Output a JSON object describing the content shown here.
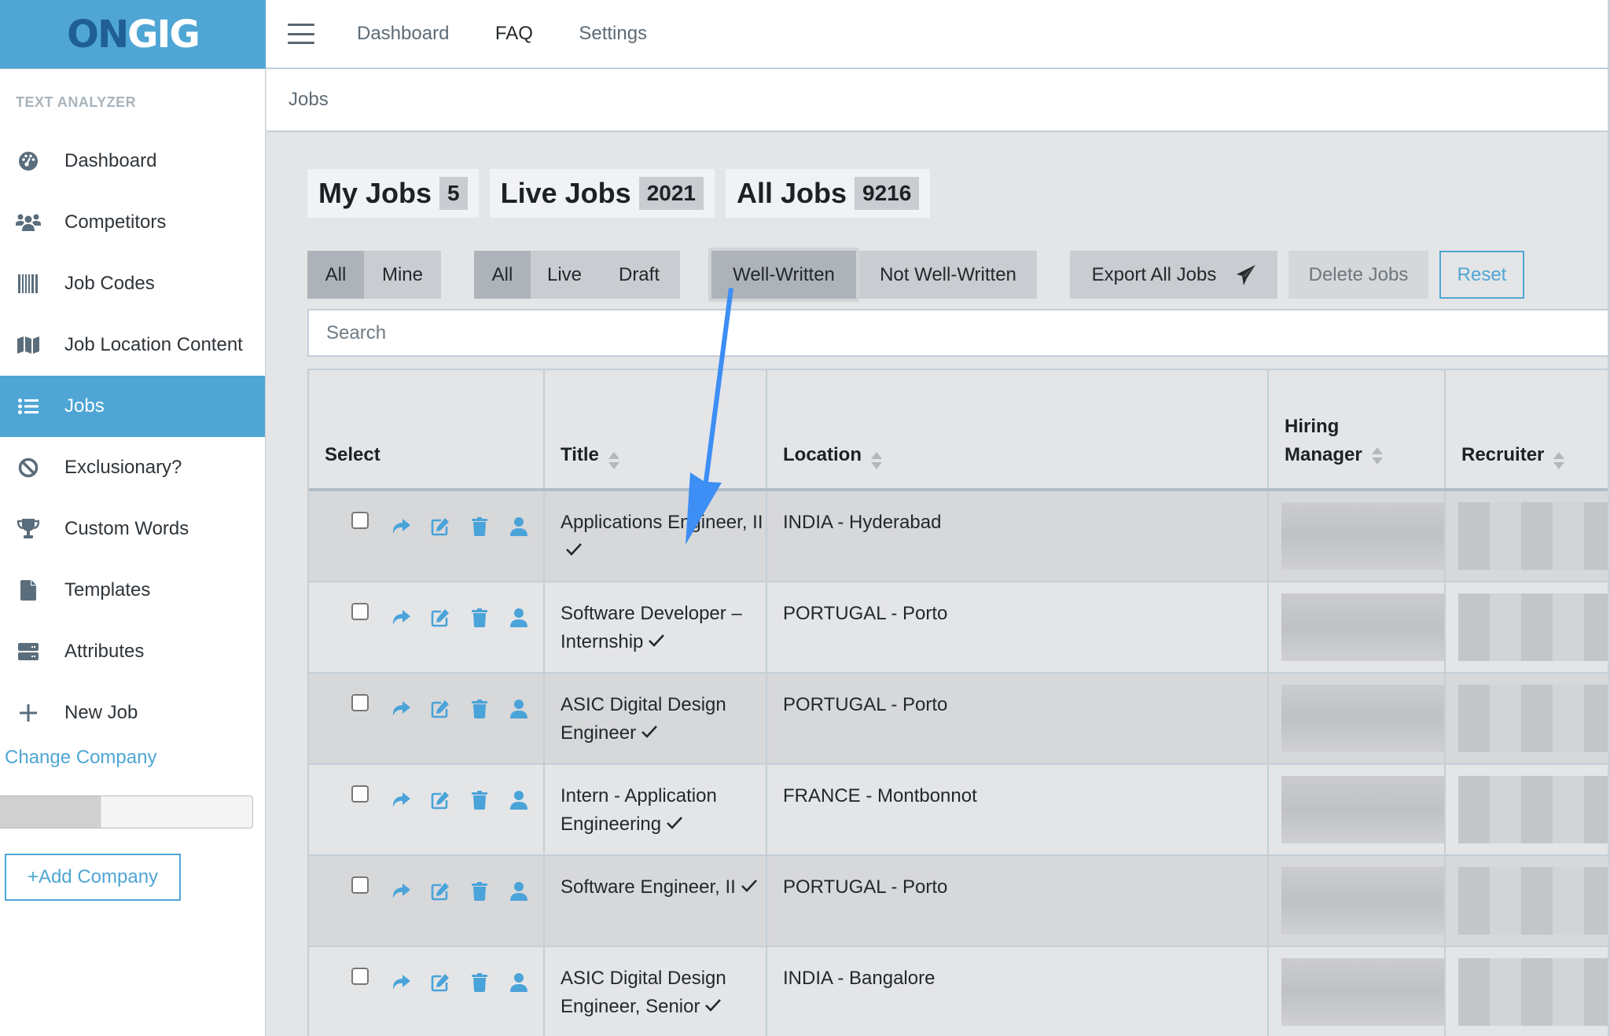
{
  "brand": {
    "logo_part1": "ON",
    "logo_part2": "GIG"
  },
  "topnav": {
    "items": [
      "Dashboard",
      "FAQ",
      "Settings"
    ]
  },
  "sidebar": {
    "section_title": "TEXT ANALYZER",
    "items": [
      {
        "label": "Dashboard",
        "icon": "tachometer-icon"
      },
      {
        "label": "Competitors",
        "icon": "users-icon"
      },
      {
        "label": "Job Codes",
        "icon": "barcode-icon"
      },
      {
        "label": "Job Location Content",
        "icon": "map-icon"
      },
      {
        "label": "Jobs",
        "icon": "list-icon",
        "active": true
      },
      {
        "label": "Exclusionary?",
        "icon": "ban-icon"
      },
      {
        "label": "Custom Words",
        "icon": "trophy-icon"
      },
      {
        "label": "Templates",
        "icon": "file-icon"
      },
      {
        "label": "Attributes",
        "icon": "server-icon"
      },
      {
        "label": "New Job",
        "icon": "plus-icon"
      }
    ],
    "change_company": "Change Company",
    "add_company": "+Add Company"
  },
  "breadcrumb": "Jobs",
  "job_tabs": [
    {
      "label": "My Jobs",
      "count": "5"
    },
    {
      "label": "Live Jobs",
      "count": "2021"
    },
    {
      "label": "All Jobs",
      "count": "9216"
    }
  ],
  "filters": {
    "owner": {
      "options": [
        "All",
        "Mine"
      ],
      "active": "All"
    },
    "status": {
      "options": [
        "All",
        "Live",
        "Draft"
      ],
      "active": "All"
    },
    "quality": {
      "options": [
        "Well-Written",
        "Not Well-Written"
      ],
      "active": "Well-Written"
    },
    "export_label": "Export All Jobs",
    "delete_label": "Delete Jobs",
    "reset_label": "Reset"
  },
  "search": {
    "placeholder": "Search",
    "value": ""
  },
  "table": {
    "columns": [
      "Select",
      "Title",
      "Location",
      "Hiring Manager",
      "Recruiter"
    ],
    "rows": [
      {
        "title": "Applications Engineer, II",
        "location": "INDIA - Hyderabad",
        "well_written": true
      },
      {
        "title": "Software Developer – Internship",
        "location": "PORTUGAL - Porto",
        "well_written": true
      },
      {
        "title": "ASIC Digital Design Engineer",
        "location": "PORTUGAL - Porto",
        "well_written": true
      },
      {
        "title": "Intern - Application Engineering",
        "location": "FRANCE - Montbonnot",
        "well_written": true
      },
      {
        "title": "Software Engineer, II",
        "location": "PORTUGAL - Porto",
        "well_written": true
      },
      {
        "title": "ASIC Digital Design Engineer, Senior",
        "location": "INDIA - Bangalore",
        "well_written": true
      }
    ]
  },
  "colors": {
    "brand_blue": "#4fa6d5",
    "logo_dark": "#1f5f95",
    "annotation_arrow": "#3d8ef5",
    "action_icon": "#4aa3d9"
  }
}
